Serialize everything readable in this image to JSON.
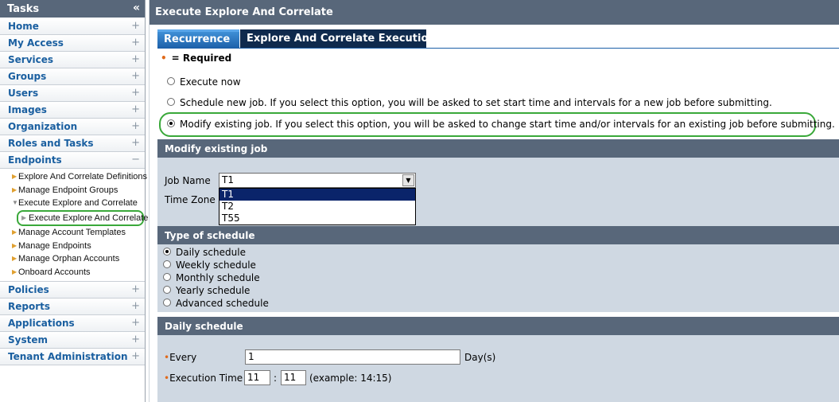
{
  "tasks_panel": {
    "title": "Tasks",
    "collapse_glyph": "«",
    "nav_top": [
      {
        "label": "Home",
        "glyph": "+"
      },
      {
        "label": "My Access",
        "glyph": "+"
      },
      {
        "label": "Services",
        "glyph": "+"
      },
      {
        "label": "Groups",
        "glyph": "+"
      },
      {
        "label": "Users",
        "glyph": "+"
      },
      {
        "label": "Images",
        "glyph": "+"
      },
      {
        "label": "Organization",
        "glyph": "+"
      },
      {
        "label": "Roles and Tasks",
        "glyph": "+"
      },
      {
        "label": "Endpoints",
        "glyph": "−"
      }
    ],
    "endpoints_items": [
      "Explore And Correlate Definitions",
      "Manage Endpoint Groups",
      "Execute Explore and Correlate",
      "Execute Explore And Correlate",
      "Manage Account Templates",
      "Manage Endpoints",
      "Manage Orphan Accounts",
      "Onboard Accounts"
    ],
    "nav_bottom": [
      {
        "label": "Policies",
        "glyph": "+"
      },
      {
        "label": "Reports",
        "glyph": "+"
      },
      {
        "label": "Applications",
        "glyph": "+"
      },
      {
        "label": "System",
        "glyph": "+"
      },
      {
        "label": "Tenant Administration",
        "glyph": "+"
      }
    ]
  },
  "main": {
    "title": "Execute Explore And Correlate",
    "tabs": [
      "Recurrence",
      "Explore And Correlate Execution"
    ],
    "required_text": "= Required",
    "required_marker": "•",
    "options": [
      {
        "label": "Execute now",
        "checked": false
      },
      {
        "label": "Schedule new job. If you select this option, you will be asked to set start time and intervals for a new job before submitting.",
        "checked": false
      },
      {
        "label": "Modify existing job. If you select this option, you will be asked to change start time and/or intervals for an existing job before submitting.",
        "checked": true
      }
    ],
    "modify_section": {
      "header": "Modify existing job",
      "job_name_label": "Job Name",
      "job_name_value": "T1",
      "time_zone_label": "Time Zone",
      "dropdown_options": [
        "T1",
        "T2",
        "T55"
      ],
      "dropdown_selected": "T1"
    },
    "type_section": {
      "header": "Type of schedule",
      "options": [
        {
          "label": "Daily schedule",
          "checked": true
        },
        {
          "label": "Weekly schedule",
          "checked": false
        },
        {
          "label": "Monthly schedule",
          "checked": false
        },
        {
          "label": "Yearly schedule",
          "checked": false
        },
        {
          "label": "Advanced schedule",
          "checked": false
        }
      ]
    },
    "daily_section": {
      "header": "Daily schedule",
      "every_label": "Every",
      "every_value": "1",
      "every_unit": "Day(s)",
      "exec_label": "Execution Time",
      "hour_value": "11",
      "separator": ":",
      "minute_value": "11",
      "example": "(example: 14:15)"
    }
  },
  "colors": {
    "header_bg": "#58677a",
    "nav_text": "#1a5fa0",
    "tab_active": "#1c5fa8",
    "tab_inactive": "#0f2a4d",
    "section_body": "#cfd8e2",
    "highlight": "#3aa83a",
    "required_dot": "#e06a1a",
    "selection": "#0a246a"
  }
}
